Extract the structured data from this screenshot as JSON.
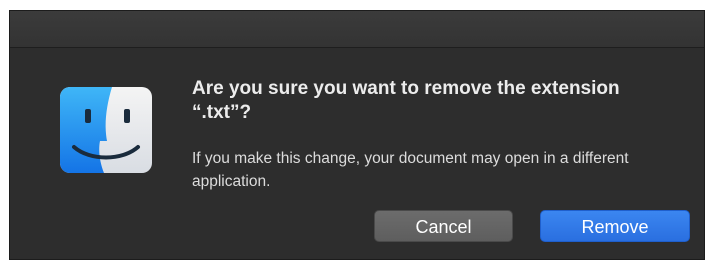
{
  "dialog": {
    "title": "Are you sure you want to remove the extension “.txt”?",
    "message": "If you make this change, your document may open in a different application.",
    "buttons": {
      "cancel_label": "Cancel",
      "remove_label": "Remove"
    },
    "icon": "finder-icon"
  },
  "colors": {
    "dialog_background": "#2d2d2d",
    "primary_button": "#2f78e8",
    "secondary_button": "#656565"
  }
}
